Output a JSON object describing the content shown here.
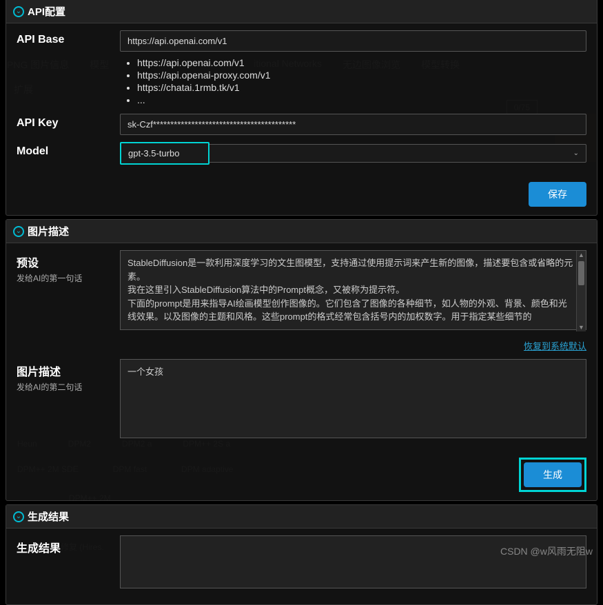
{
  "api_config": {
    "title": "API配置",
    "api_base": {
      "label": "API Base",
      "value": "https://api.openai.com/v1",
      "hints": [
        "https://api.openai.com/v1",
        "https://api.openai-proxy.com/v1",
        "https://chatai.1rmb.tk/v1",
        "..."
      ]
    },
    "api_key": {
      "label": "API Key",
      "value": "sk-Czf*****************************************"
    },
    "model": {
      "label": "Model",
      "value": "gpt-3.5-turbo"
    },
    "save_label": "保存"
  },
  "image_desc": {
    "title": "图片描述",
    "preset": {
      "label": "预设",
      "sublabel": "发给AI的第一句话",
      "value": "StableDiffusion是一款利用深度学习的文生图模型，支持通过使用提示词来产生新的图像，描述要包含或省略的元素。\n我在这里引入StableDiffusion算法中的Prompt概念，又被称为提示符。\n下面的prompt是用来指导AI绘画模型创作图像的。它们包含了图像的各种细节，如人物的外观、背景、颜色和光线效果。以及图像的主题和风格。这些prompt的格式经常包含括号内的加权数字。用于指定某些细节的"
    },
    "restore_link": "恢复到系统默认",
    "desc": {
      "label": "图片描述",
      "sublabel": "发给AI的第二句话",
      "value": "一个女孩"
    },
    "generate_label": "生成"
  },
  "result": {
    "title": "生成结果",
    "label": "生成结果",
    "value": ""
  },
  "bg": {
    "tabs": [
      "PNG 图片信息",
      "模型",
      "",
      "",
      "itional Networks",
      "无边图像浏览",
      "模型转换"
    ],
    "ext": "扩展",
    "counter": "0/75",
    "samplers1": [
      "Heun",
      "DPM2",
      "DPM2 a",
      "DPM++ 2S a"
    ],
    "samplers2": [
      "DPM++ 2M SDE",
      "DPM fast",
      "DPM adaptive"
    ],
    "samplers3": "DPM++ 2M",
    "hires": "高分辨率修复 (Hires."
  },
  "watermark": "CSDN @w风雨无阻w"
}
